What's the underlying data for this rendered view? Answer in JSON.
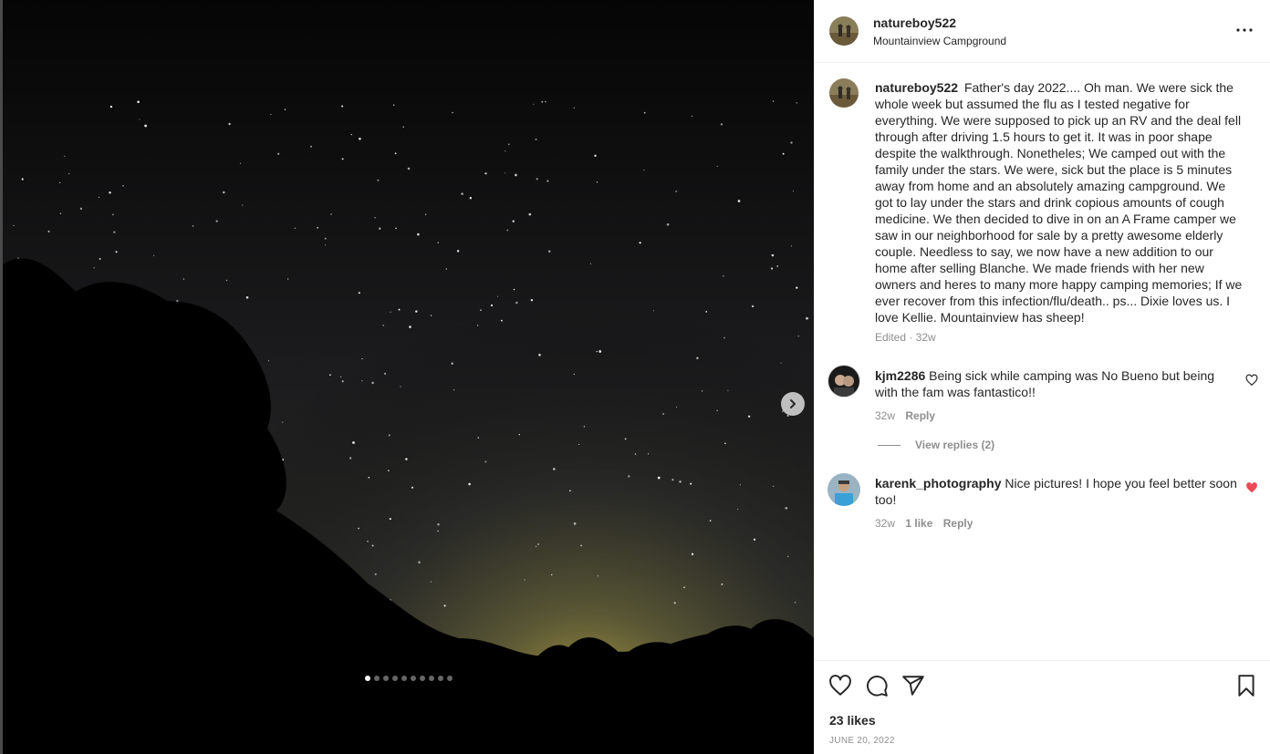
{
  "post": {
    "username": "natureboy522",
    "location": "Mountainview Campground",
    "caption": "Father's day 2022.... Oh man. We were sick the whole week but assumed the flu as I tested negative for everything. We were supposed to pick up an RV and the deal fell through after driving 1.5 hours to get it. It was in poor shape despite the walkthrough. Nonetheles; We camped out with the family under the stars. We were, sick but the place is 5 minutes away from home and an absolutely amazing campground. We got to lay under the stars and drink copious amounts of cough medicine. We then decided to dive in on an A Frame camper we saw in our neighborhood for sale by a pretty awesome elderly couple. Needless to say, we now have a new addition to our home after selling Blanche. We made friends with her new owners and heres to many more happy camping memories; If we ever recover from this infection/flu/death.. ps... Dixie loves us. I love Kellie. Mountainview has sheep!",
    "caption_meta": "Edited · 32w",
    "likes": "23 likes",
    "date": "JUNE 20, 2022"
  },
  "media": {
    "slide_count": 10,
    "active_slide": 1
  },
  "comments": [
    {
      "username": "kjm2286",
      "text": "Being sick while camping was No Bueno but being with the fam was fantastico!!",
      "age": "32w",
      "likes": "",
      "reply_label": "Reply",
      "liked": false,
      "view_replies": "View replies (2)"
    },
    {
      "username": "karenk_photography",
      "text": "Nice pictures! I hope you feel better soon too!",
      "age": "32w",
      "likes": "1 like",
      "reply_label": "Reply",
      "liked": true
    }
  ],
  "colors": {
    "liked_heart": "#ed4956",
    "muted": "#8e8e8e",
    "text": "#262626"
  },
  "icons": [
    "more-options-icon",
    "next-arrow-icon",
    "heart-icon",
    "comment-icon",
    "share-icon",
    "bookmark-icon"
  ]
}
